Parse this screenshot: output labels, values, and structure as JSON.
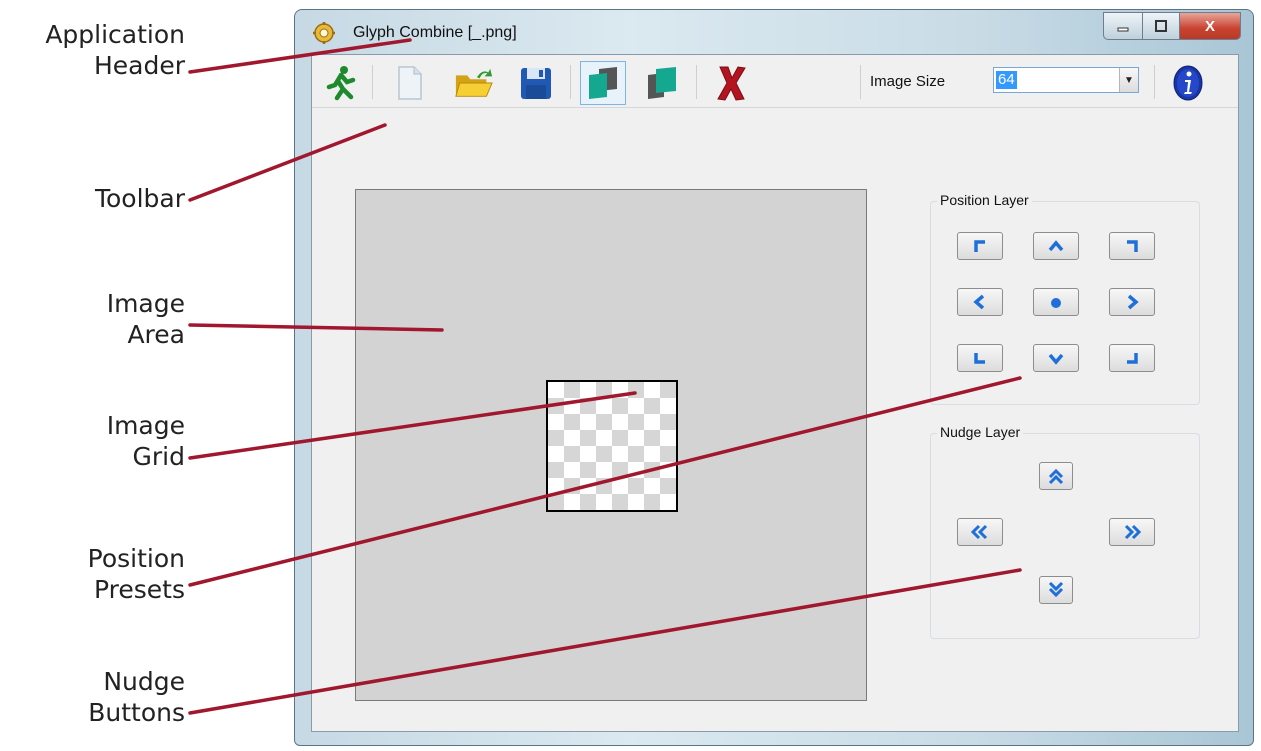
{
  "window": {
    "title": "Glyph Combine [_.png]",
    "close_glyph": "X"
  },
  "toolbar": {
    "buttons": [
      {
        "name": "exit",
        "icon": "running-man-exit-icon"
      },
      {
        "name": "new",
        "icon": "blank-page-icon"
      },
      {
        "name": "open",
        "icon": "open-folder-icon"
      },
      {
        "name": "save",
        "icon": "floppy-disk-icon"
      },
      {
        "name": "layer-back",
        "icon": "layers-back-icon"
      },
      {
        "name": "layer-front",
        "icon": "layers-front-icon"
      },
      {
        "name": "delete",
        "icon": "red-x-icon"
      },
      {
        "name": "info",
        "icon": "info-icon"
      }
    ],
    "image_size_label": "Image Size",
    "image_size_value": "64"
  },
  "position_layer": {
    "title": "Position Layer",
    "buttons": [
      "top-left",
      "top",
      "top-right",
      "left",
      "center",
      "right",
      "bottom-left",
      "bottom",
      "bottom-right"
    ]
  },
  "nudge_layer": {
    "title": "Nudge Layer",
    "buttons": [
      "up",
      "left",
      "right",
      "down"
    ]
  },
  "callouts": [
    {
      "lines": [
        "Application",
        "Header"
      ]
    },
    {
      "lines": [
        "Toolbar"
      ]
    },
    {
      "lines": [
        "Image",
        "Area"
      ]
    },
    {
      "lines": [
        "Image",
        "Grid"
      ]
    },
    {
      "lines": [
        "Position",
        "Presets"
      ]
    },
    {
      "lines": [
        "Nudge",
        "Buttons"
      ]
    }
  ],
  "colors": {
    "leader_line": "#a0172e",
    "icon_blue": "#1e6fd9"
  }
}
